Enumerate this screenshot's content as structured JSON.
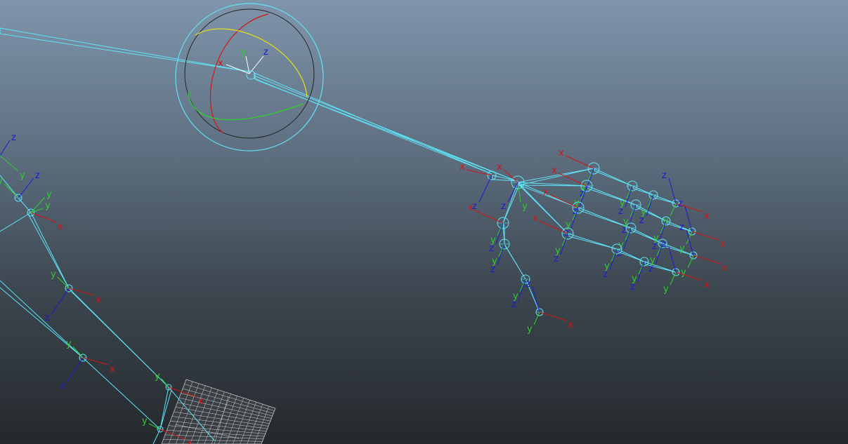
{
  "viewport": {
    "name": "3D viewport",
    "background_top": "#7f95ab",
    "background_bottom": "#24282c",
    "joint_color": "#5fe3f7",
    "axis_colors": {
      "x": "#d41414",
      "y": "#2ecf2e",
      "z": "#1b1bd8"
    }
  },
  "axis_labels": {
    "x": "x",
    "y": "y",
    "z": "z"
  },
  "rotate_manipulator": {
    "ring_colors": {
      "x": "#d41414",
      "y": "#2ecf2e",
      "z": "#e6e01a",
      "outer": "#5fe3f7",
      "view": "#222222"
    }
  }
}
